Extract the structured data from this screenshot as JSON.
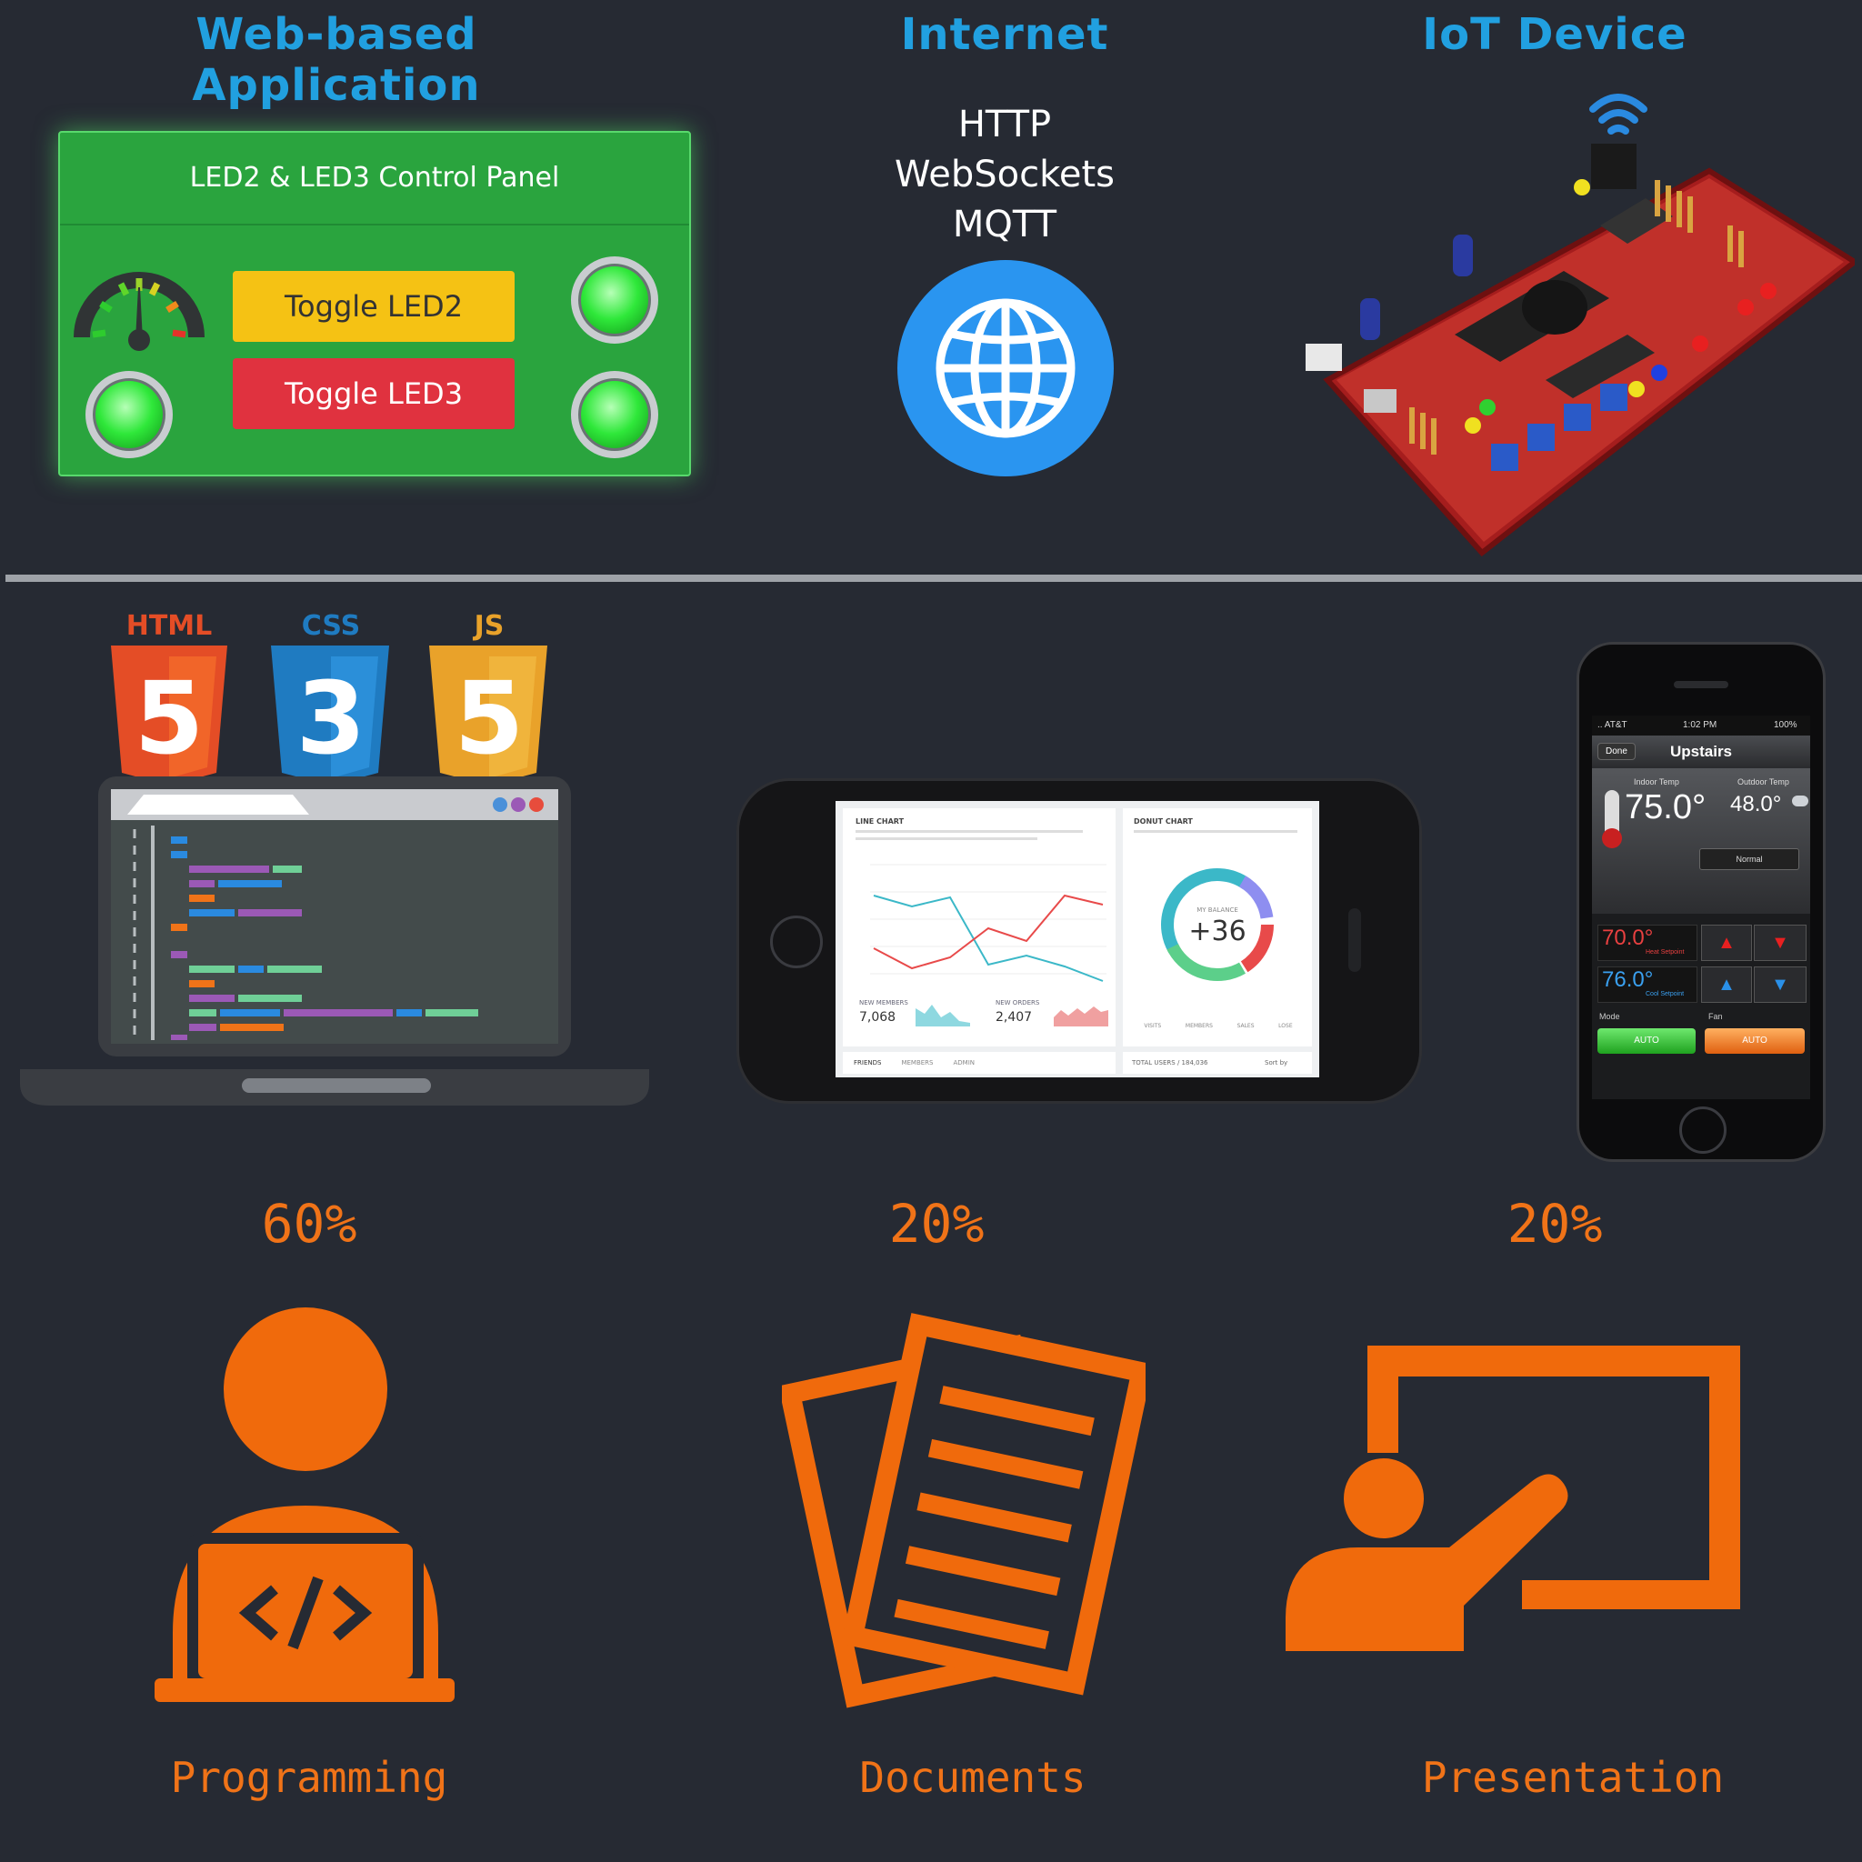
{
  "headings": {
    "web_app": "Web-based Application",
    "internet": "Internet",
    "iot": "IoT Device"
  },
  "protocols": [
    "HTTP",
    "WebSockets",
    "MQTT"
  ],
  "control_panel": {
    "title": "LED2 & LED3 Control Panel",
    "toggle_led2": "Toggle LED2",
    "toggle_led3": "Toggle LED3"
  },
  "tech_badges": {
    "html": {
      "label": "HTML",
      "number": "5",
      "color": "#e44d26"
    },
    "css": {
      "label": "CSS",
      "number": "3",
      "color": "#1f7bc1"
    },
    "js": {
      "label": "JS",
      "number": "5",
      "color": "#e9a22a"
    }
  },
  "dashboard": {
    "line_chart": "LINE CHART",
    "donut_chart": "DONUT CHART",
    "balance_label": "MY BALANCE",
    "balance_value": "+36",
    "new_members_label": "NEW MEMBERS",
    "new_members_value": "7,068",
    "new_orders_label": "NEW ORDERS",
    "new_orders_value": "2,407",
    "tabs": [
      "FRIENDS",
      "MEMBERS",
      "ADMIN"
    ],
    "total_users": "TOTAL USERS / 184,036",
    "sort_by": "Sort by",
    "stat_labels": [
      "VISITS",
      "MEMBERS",
      "SALES",
      "LOSE"
    ]
  },
  "thermostat": {
    "carrier": ".. AT&T",
    "time": "1:02 PM",
    "battery": "100%",
    "done": "Done",
    "title": "Upstairs",
    "indoor_label": "Indoor Temp",
    "indoor_value": "75.0°",
    "outdoor_label": "Outdoor Temp",
    "outdoor_value": "48.0°",
    "mode_select": "Normal",
    "heat_value": "70.0°",
    "heat_label": "Heat Setpoint",
    "cool_value": "76.0°",
    "cool_label": "Cool Setpoint",
    "mode_label": "Mode",
    "fan_label": "Fan",
    "mode_btn": "AUTO",
    "fan_btn": "AUTO"
  },
  "shares": [
    {
      "percent": "60%",
      "label": "Programming"
    },
    {
      "percent": "20%",
      "label": "Documents"
    },
    {
      "percent": "20%",
      "label": "Presentation"
    }
  ],
  "colors": {
    "background": "#262a33",
    "heading_blue": "#21a0e0",
    "accent_orange": "#f07318",
    "panel_green": "#2aa43e",
    "btn_yellow": "#f5c214",
    "btn_red": "#e0323f"
  }
}
